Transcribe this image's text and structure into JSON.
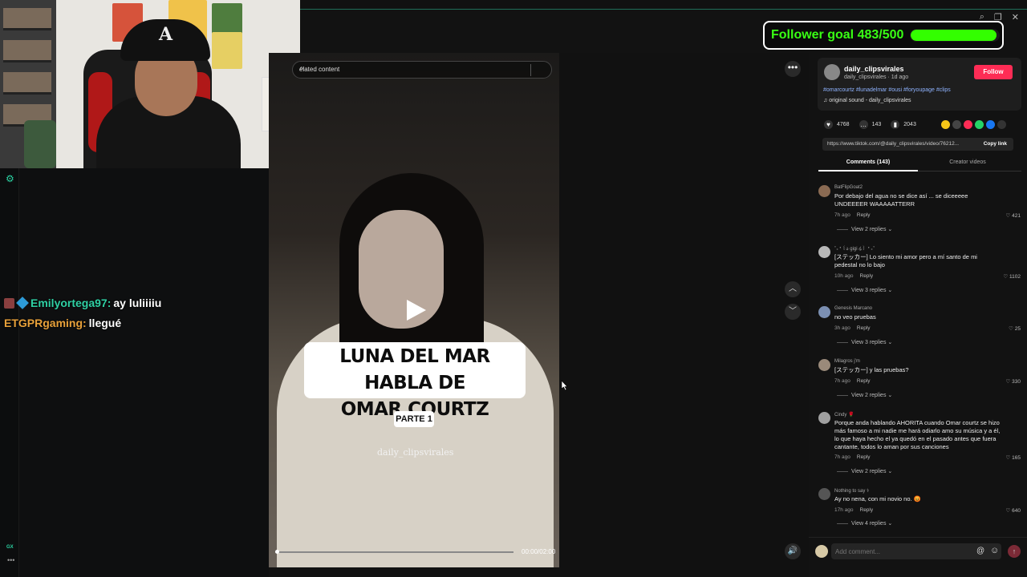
{
  "stream": {
    "follower_goal": {
      "label": "Follower goal 483/500",
      "current": 483,
      "target": 500,
      "fraction": 0.966
    },
    "chat": [
      {
        "user": "Emilyortega97:",
        "message": "ay luliiiiu",
        "user_color": "#2fd0a4"
      },
      {
        "user": "ETGPRgaming:",
        "message": "llegué",
        "user_color": "#e8a13a"
      }
    ],
    "side": {
      "gx_label": "GX",
      "dots": "•••"
    }
  },
  "webcam": {
    "cap_logo": "A"
  },
  "player": {
    "search_placeholder": "elated content",
    "overlay_title_line1": "LUNA DEL MAR HABLA DE",
    "overlay_title_line2": "OMAR COURTZ",
    "overlay_part": "PARTE 1",
    "watermark": "daily_clipsvirales",
    "time": "00:00/02:00",
    "progress_fraction": 0.0,
    "more": "•••"
  },
  "post": {
    "username": "daily_clipsvirales",
    "meta": "daily_clipsvirales · 1d ago",
    "follow_label": "Follow",
    "hashtags": "#omarcourtz #lunadelmar #ousi #foryoupage #clips",
    "sound": "original sound - daily_clipsvirales",
    "likes": "4768",
    "comments": "143",
    "saves": "2043",
    "url": "https://www.tiktok.com/@daily_clipsvirales/video/76212...",
    "copy_label": "Copy link",
    "share_colors": [
      "#f5c518",
      "#444444",
      "#fe2c55",
      "#25d366",
      "#1877f2",
      "#333333"
    ]
  },
  "tabs": {
    "comments": "Comments (143)",
    "creator": "Creator videos"
  },
  "comments": [
    {
      "name": "BatFlipGoat2",
      "text": "Por debajo del agua no se dice así ... se diceeeee UNDEEEER WAAAAATTERR",
      "age": "7h ago",
      "reply": "Reply",
      "likes": "421",
      "view": "View 2 replies",
      "avatar": "#8a6a52"
    },
    {
      "name": "˚₊‧꒰ა gigi ໒꒱ ‧₊˚",
      "text": "[ステッカー] Lo siento mi amor pero a mí santo de mi pedestal no lo bajo",
      "age": "10h ago",
      "reply": "Reply",
      "likes": "1102",
      "view": "View 3 replies",
      "avatar": "#b8b8b8"
    },
    {
      "name": "Genesis Marcano",
      "text": "no veo pruebas",
      "age": "3h ago",
      "reply": "Reply",
      "likes": "25",
      "view": "View 3 replies",
      "avatar": "#7b8fb2"
    },
    {
      "name": "Milagros j'm",
      "text": "[ステッカー] y las pruebas?",
      "age": "7h ago",
      "reply": "Reply",
      "likes": "330",
      "view": "View 2 replies",
      "avatar": "#9a8a7a"
    },
    {
      "name": "Cindy 🌹",
      "text": "Porque anda hablando AHORITA cuando Omar courtz se hizo más famoso a mi nadie me hará odiarlo amo su música y a él, lo que haya hecho el ya quedó en el pasado antes que fuera cantante, todos lo aman por sus canciones",
      "age": "7h ago",
      "reply": "Reply",
      "likes": "165",
      "view": "View 2 replies",
      "avatar": "#a0a0a0"
    },
    {
      "name": "Nothing to say ⚕",
      "text": "Ay no nena, con mi novio no. 😡",
      "age": "17h ago",
      "reply": "Reply",
      "likes": "640",
      "view": "View 4 replies",
      "avatar": "#555555"
    }
  ],
  "add_comment": {
    "placeholder": "Add comment...",
    "at": "@",
    "emoji": "☺",
    "send": "↑"
  }
}
